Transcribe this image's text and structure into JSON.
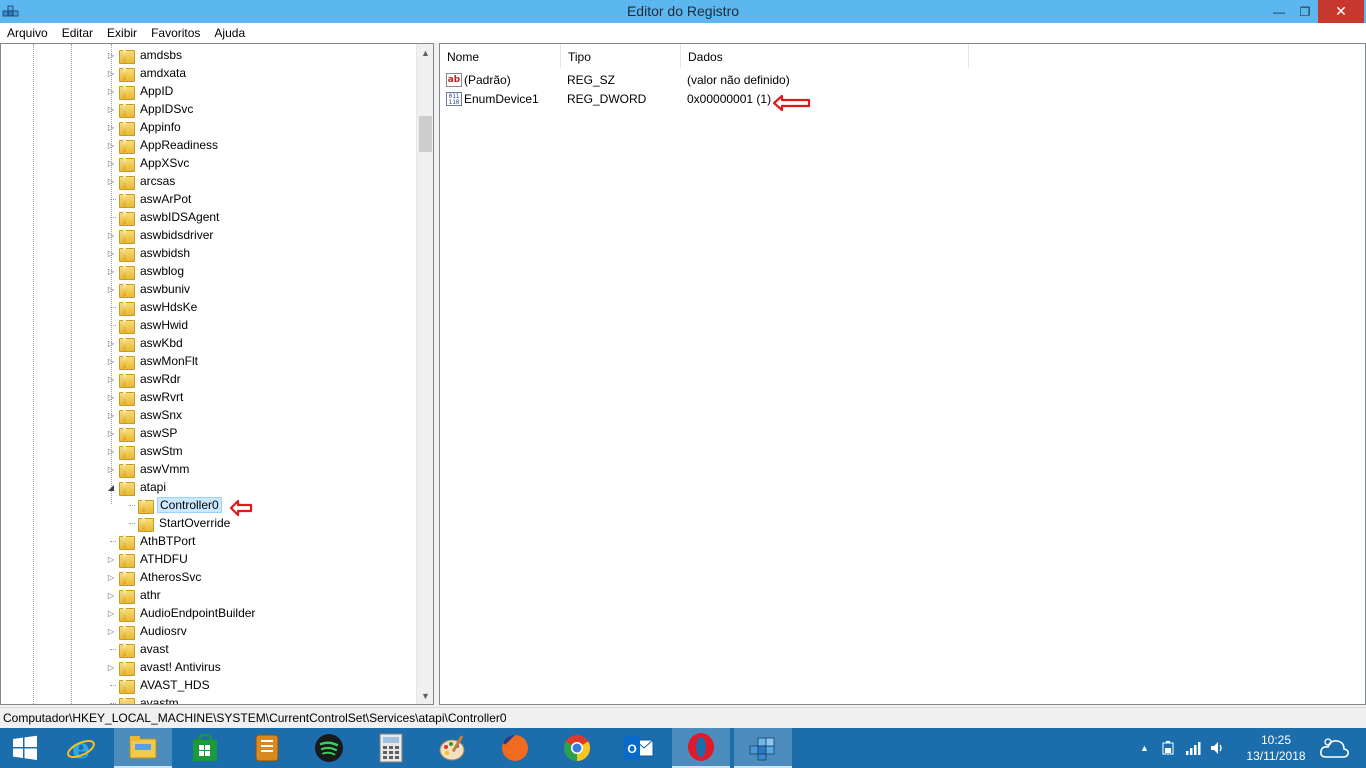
{
  "window": {
    "title": "Editor do Registro",
    "min_glyph": "—",
    "max_glyph": "❐",
    "close_glyph": "✕"
  },
  "menu": [
    "Arquivo",
    "Editar",
    "Exibir",
    "Favoritos",
    "Ajuda"
  ],
  "tree": {
    "items": [
      {
        "label": "amdsbs",
        "level": 0,
        "expander": "collapsed"
      },
      {
        "label": "amdxata",
        "level": 0,
        "expander": "collapsed"
      },
      {
        "label": "AppID",
        "level": 0,
        "expander": "collapsed"
      },
      {
        "label": "AppIDSvc",
        "level": 0,
        "expander": "collapsed"
      },
      {
        "label": "Appinfo",
        "level": 0,
        "expander": "collapsed"
      },
      {
        "label": "AppReadiness",
        "level": 0,
        "expander": "collapsed"
      },
      {
        "label": "AppXSvc",
        "level": 0,
        "expander": "collapsed"
      },
      {
        "label": "arcsas",
        "level": 0,
        "expander": "collapsed"
      },
      {
        "label": "aswArPot",
        "level": 0,
        "expander": "none"
      },
      {
        "label": "aswbIDSAgent",
        "level": 0,
        "expander": "none"
      },
      {
        "label": "aswbidsdriver",
        "level": 0,
        "expander": "collapsed"
      },
      {
        "label": "aswbidsh",
        "level": 0,
        "expander": "collapsed"
      },
      {
        "label": "aswblog",
        "level": 0,
        "expander": "collapsed"
      },
      {
        "label": "aswbuniv",
        "level": 0,
        "expander": "collapsed"
      },
      {
        "label": "aswHdsKe",
        "level": 0,
        "expander": "none"
      },
      {
        "label": "aswHwid",
        "level": 0,
        "expander": "none"
      },
      {
        "label": "aswKbd",
        "level": 0,
        "expander": "collapsed"
      },
      {
        "label": "aswMonFlt",
        "level": 0,
        "expander": "collapsed"
      },
      {
        "label": "aswRdr",
        "level": 0,
        "expander": "collapsed"
      },
      {
        "label": "aswRvrt",
        "level": 0,
        "expander": "collapsed"
      },
      {
        "label": "aswSnx",
        "level": 0,
        "expander": "collapsed"
      },
      {
        "label": "aswSP",
        "level": 0,
        "expander": "collapsed"
      },
      {
        "label": "aswStm",
        "level": 0,
        "expander": "collapsed"
      },
      {
        "label": "aswVmm",
        "level": 0,
        "expander": "collapsed"
      },
      {
        "label": "atapi",
        "level": 0,
        "expander": "expanded"
      },
      {
        "label": "Controller0",
        "level": 1,
        "expander": "none",
        "selected": true
      },
      {
        "label": "StartOverride",
        "level": 1,
        "expander": "none"
      },
      {
        "label": "AthBTPort",
        "level": 0,
        "expander": "none"
      },
      {
        "label": "ATHDFU",
        "level": 0,
        "expander": "collapsed"
      },
      {
        "label": "AtherosSvc",
        "level": 0,
        "expander": "collapsed"
      },
      {
        "label": "athr",
        "level": 0,
        "expander": "collapsed"
      },
      {
        "label": "AudioEndpointBuilder",
        "level": 0,
        "expander": "collapsed"
      },
      {
        "label": "Audiosrv",
        "level": 0,
        "expander": "collapsed"
      },
      {
        "label": "avast",
        "level": 0,
        "expander": "none"
      },
      {
        "label": "avast! Antivirus",
        "level": 0,
        "expander": "collapsed"
      },
      {
        "label": "AVAST_HDS",
        "level": 0,
        "expander": "none"
      },
      {
        "label": "avastm",
        "level": 0,
        "expander": "none"
      }
    ]
  },
  "values": {
    "columns": [
      "Nome",
      "Tipo",
      "Dados"
    ],
    "rows": [
      {
        "icon": "string-value-icon",
        "icon_text": "ab",
        "name": "(Padrão)",
        "type": "REG_SZ",
        "data": "(valor não definido)"
      },
      {
        "icon": "binary-value-icon",
        "icon_text": "011 110",
        "name": "EnumDevice1",
        "type": "REG_DWORD",
        "data": "0x00000001 (1)"
      }
    ]
  },
  "statusbar": {
    "path": "Computador\\HKEY_LOCAL_MACHINE\\SYSTEM\\CurrentControlSet\\Services\\atapi\\Controller0"
  },
  "taskbar": {
    "apps": [
      "windows-start-icon",
      "internet-explorer-icon",
      "file-explorer-icon",
      "store-icon",
      "notes-icon",
      "spotify-icon",
      "calculator-icon",
      "paint-icon",
      "firefox-icon",
      "chrome-icon",
      "outlook-icon",
      "opera-icon",
      "regedit-icon"
    ],
    "time": "10:25",
    "date": "13/11/2018"
  },
  "colors": {
    "titlebar": "#5cb7f0",
    "close": "#c8372d",
    "taskbar": "#1c6dab",
    "annotation_arrow": "#e01a1a",
    "selection": "#cce8ff"
  }
}
